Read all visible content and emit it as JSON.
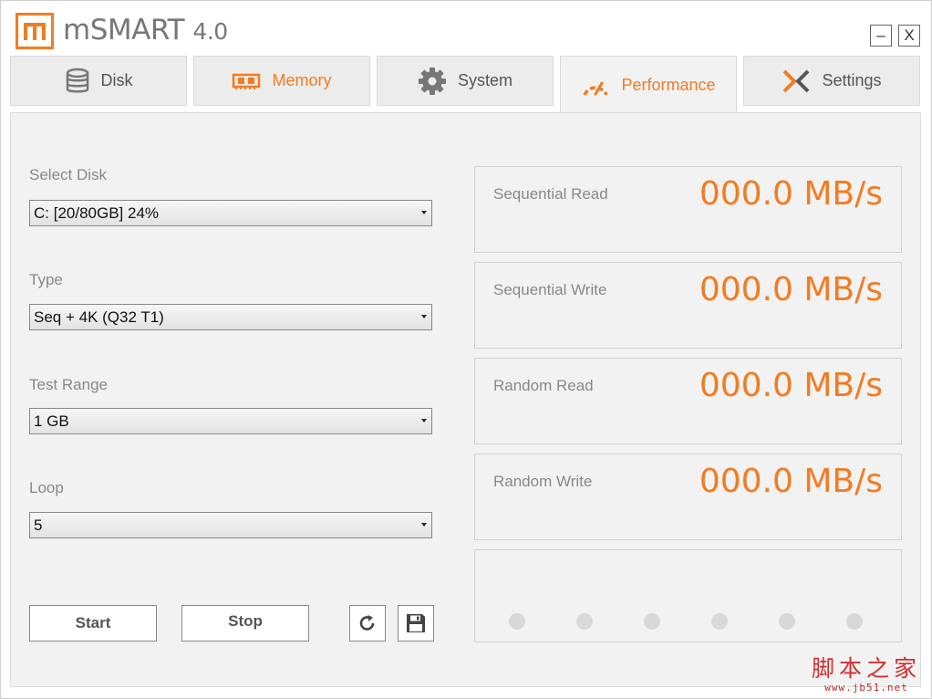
{
  "app": {
    "title": "mSMART",
    "version": "4.0",
    "minimize_label": "–",
    "close_label": "X"
  },
  "colors": {
    "accent": "#f47b20",
    "panel": "#f2f2f2",
    "label_gray": "#888888"
  },
  "tabs": [
    {
      "label": "Disk",
      "icon": "database-icon",
      "active": false
    },
    {
      "label": "Memory",
      "icon": "memory-chip-icon",
      "active": false
    },
    {
      "label": "System",
      "icon": "gear-icon",
      "active": false
    },
    {
      "label": "Performance",
      "icon": "speedometer-icon",
      "active": true
    },
    {
      "label": "Settings",
      "icon": "x-logo-icon",
      "active": false
    }
  ],
  "form": {
    "select_disk": {
      "label": "Select Disk",
      "value": "C: [20/80GB] 24%"
    },
    "type": {
      "label": "Type",
      "value": "Seq + 4K (Q32 T1)"
    },
    "test_range": {
      "label": "Test Range",
      "value": "1 GB"
    },
    "loop": {
      "label": "Loop",
      "value": "5"
    }
  },
  "buttons": {
    "start": "Start",
    "stop": "Stop",
    "refresh_icon": "refresh-icon",
    "save_icon": "save-icon"
  },
  "results": [
    {
      "label": "Sequential Read",
      "value": "000.0 MB/s"
    },
    {
      "label": "Sequential Write",
      "value": "000.0 MB/s"
    },
    {
      "label": "Random Read",
      "value": "000.0 MB/s"
    },
    {
      "label": "Random Write",
      "value": "000.0 MB/s"
    }
  ],
  "progress": {
    "dots_total": 6,
    "dots_active": 0
  },
  "watermark": {
    "text": "脚本之家",
    "url": "www.jb51.net"
  }
}
